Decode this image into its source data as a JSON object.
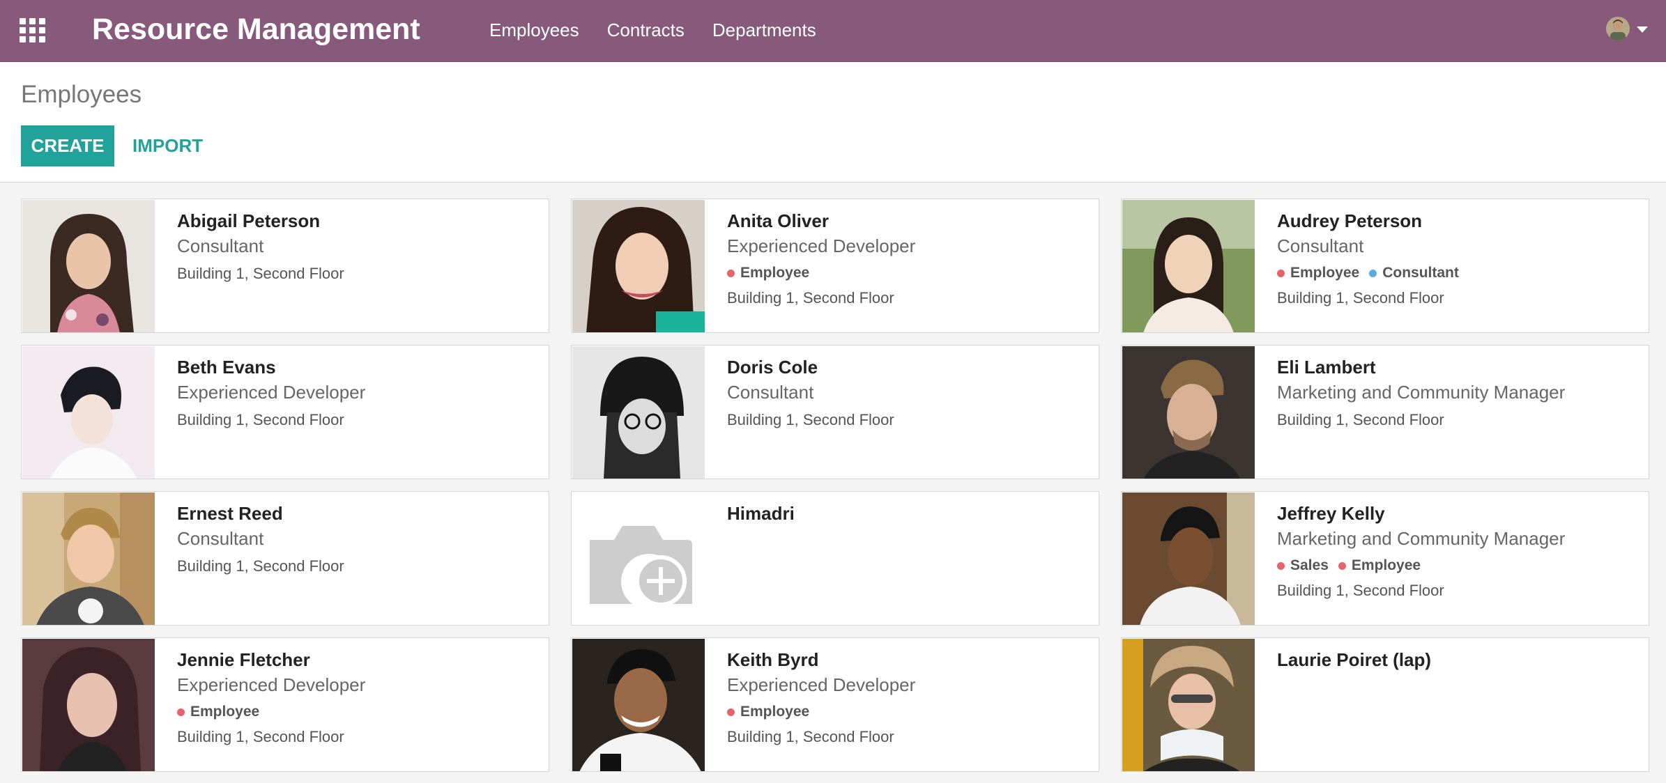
{
  "app": {
    "title": "Resource Management",
    "menu": [
      "Employees",
      "Contracts",
      "Departments"
    ]
  },
  "control_panel": {
    "title": "Employees",
    "create_label": "CREATE",
    "import_label": "IMPORT"
  },
  "colors": {
    "navbar": "#875a7b",
    "primary": "#21a39b",
    "tag_red": "#e5646a",
    "tag_blue": "#5aace4"
  },
  "employees": [
    {
      "name": "Abigail Peterson",
      "job": "Consultant",
      "tags": [],
      "location": "Building 1, Second Floor"
    },
    {
      "name": "Anita Oliver",
      "job": "Experienced Developer",
      "tags": [
        {
          "label": "Employee",
          "color": "#e5646a"
        }
      ],
      "location": "Building 1, Second Floor"
    },
    {
      "name": "Audrey Peterson",
      "job": "Consultant",
      "tags": [
        {
          "label": "Employee",
          "color": "#e5646a"
        },
        {
          "label": "Consultant",
          "color": "#5aace4"
        }
      ],
      "location": "Building 1, Second Floor"
    },
    {
      "name": "Beth Evans",
      "job": "Experienced Developer",
      "tags": [],
      "location": "Building 1, Second Floor"
    },
    {
      "name": "Doris Cole",
      "job": "Consultant",
      "tags": [],
      "location": "Building 1, Second Floor"
    },
    {
      "name": "Eli Lambert",
      "job": "Marketing and Community Manager",
      "tags": [],
      "location": "Building 1, Second Floor"
    },
    {
      "name": "Ernest Reed",
      "job": "Consultant",
      "tags": [],
      "location": "Building 1, Second Floor"
    },
    {
      "name": "Himadri",
      "job": "",
      "tags": [],
      "location": ""
    },
    {
      "name": "Jeffrey Kelly",
      "job": "Marketing and Community Manager",
      "tags": [
        {
          "label": "Sales",
          "color": "#e5646a"
        },
        {
          "label": "Employee",
          "color": "#e5646a"
        }
      ],
      "location": "Building 1, Second Floor"
    },
    {
      "name": "Jennie Fletcher",
      "job": "Experienced Developer",
      "tags": [
        {
          "label": "Employee",
          "color": "#e5646a"
        }
      ],
      "location": "Building 1, Second Floor"
    },
    {
      "name": "Keith Byrd",
      "job": "Experienced Developer",
      "tags": [
        {
          "label": "Employee",
          "color": "#e5646a"
        }
      ],
      "location": "Building 1, Second Floor"
    },
    {
      "name": "Laurie Poiret (lap)",
      "job": "",
      "tags": [],
      "location": ""
    }
  ]
}
